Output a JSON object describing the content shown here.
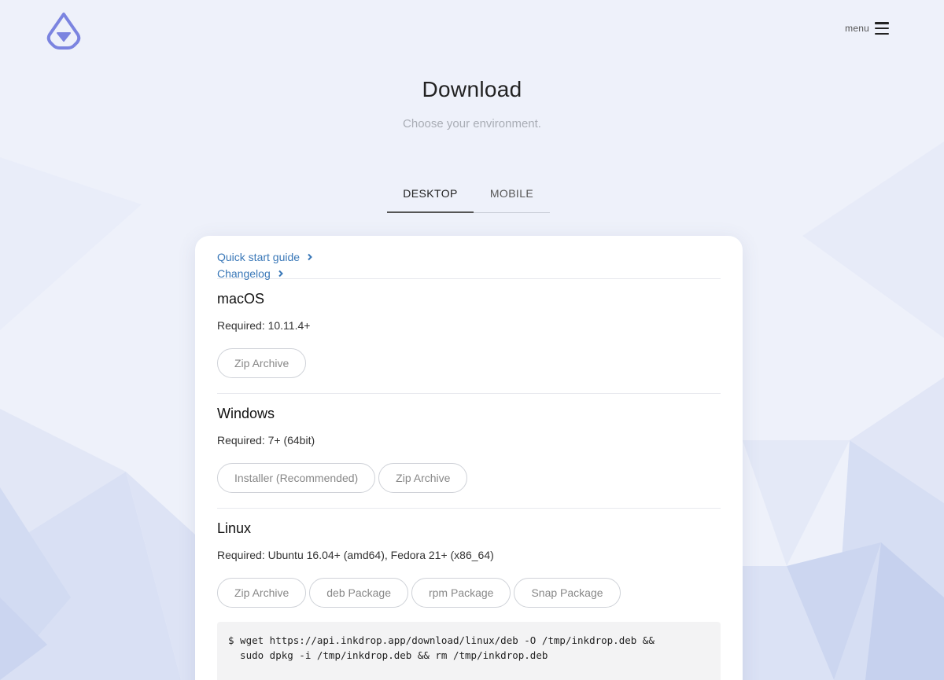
{
  "header": {
    "logo_icon": "inkdrop-logo-icon",
    "menu_label": "menu",
    "menu_icon": "hamburger-icon"
  },
  "hero": {
    "title": "Download",
    "subtitle": "Choose your environment."
  },
  "tabs": [
    {
      "label": "DESKTOP",
      "active": true
    },
    {
      "label": "MOBILE",
      "active": false
    }
  ],
  "links": {
    "quick_start": "Quick start guide",
    "changelog": "Changelog"
  },
  "platforms": {
    "macos": {
      "name": "macOS",
      "required": "Required: 10.11.4+",
      "buttons": [
        "Zip Archive"
      ]
    },
    "windows": {
      "name": "Windows",
      "required": "Required: 7+ (64bit)",
      "buttons": [
        "Installer (Recommended)",
        "Zip Archive"
      ]
    },
    "linux": {
      "name": "Linux",
      "required": "Required: Ubuntu 16.04+ (amd64), Fedora 21+ (x86_64)",
      "buttons": [
        "Zip Archive",
        "deb Package",
        "rpm Package",
        "Snap Package"
      ],
      "command": "$ wget https://api.inkdrop.app/download/linux/deb -O /tmp/inkdrop.deb &&\n  sudo dpkg -i /tmp/inkdrop.deb && rm /tmp/inkdrop.deb"
    }
  },
  "colors": {
    "accent": "#3a78b8",
    "logo": "#7b84e0",
    "background": "#edf0fa"
  }
}
